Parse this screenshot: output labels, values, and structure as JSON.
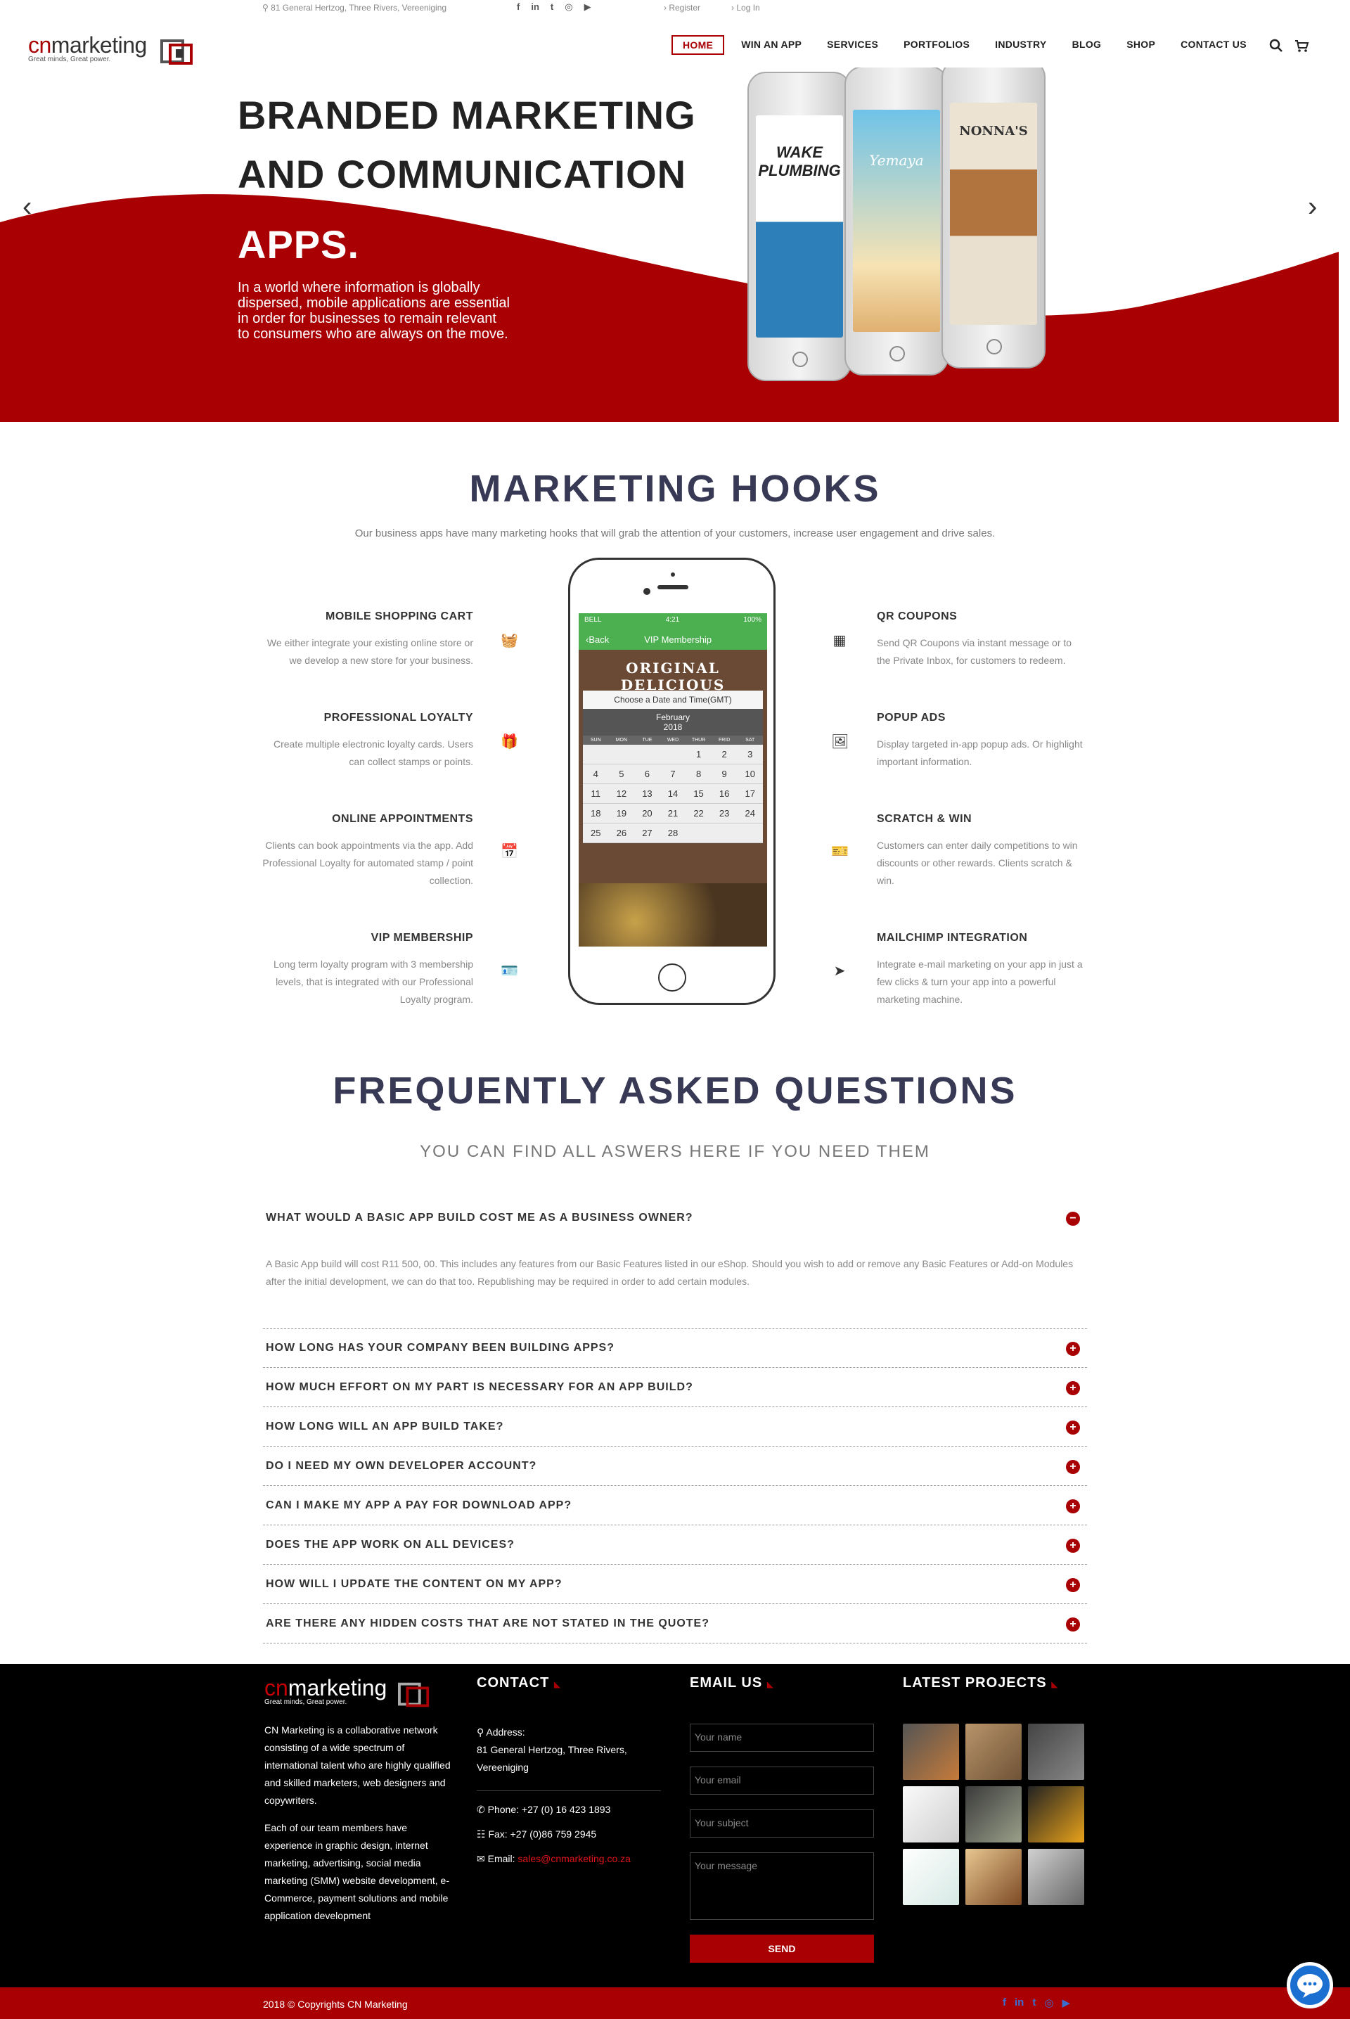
{
  "topbar": {
    "address": "81 General Hertzog, Three Rivers, Vereeniging",
    "register": "Register",
    "login": "Log In"
  },
  "logo": {
    "brand_prefix": "cn",
    "brand_suffix": "marketing",
    "tagline": "Great minds, Great power."
  },
  "nav": {
    "items": [
      "HOME",
      "WIN AN APP",
      "SERVICES",
      "PORTFOLIOS",
      "INDUSTRY",
      "BLOG",
      "SHOP",
      "CONTACT US"
    ]
  },
  "hero": {
    "title_line1": "BRANDED MARKETING",
    "title_line2": "AND COMMUNICATION",
    "title_line3": "APPS.",
    "text": "In a world where information is globally dispersed, mobile applications are essential in order for businesses to remain relevant to consumers who are always on the move.",
    "phones": [
      "WAKE PLUMBING",
      "Yemaya",
      "NONNA'S"
    ]
  },
  "hooks": {
    "title": "MARKETING HOOKS",
    "subtitle": "Our business apps have many marketing hooks that will grab the attention of your customers, increase user engagement and drive sales.",
    "left": [
      {
        "title": "MOBILE SHOPPING CART",
        "text": "We either integrate your existing online store or we develop a new store for your business.",
        "icon": "basket-icon"
      },
      {
        "title": "PROFESSIONAL LOYALTY",
        "text": "Create multiple electronic loyalty cards. Users can collect stamps or points.",
        "icon": "gift-icon"
      },
      {
        "title": "ONLINE APPOINTMENTS",
        "text": "Clients can book appointments via the app. Add Professional Loyalty for automated stamp / point collection.",
        "icon": "calendar-clock-icon"
      },
      {
        "title": "VIP MEMBERSHIP",
        "text": "Long term loyalty program with 3 membership levels, that is integrated with our Professional Loyalty program.",
        "icon": "id-card-icon"
      }
    ],
    "right": [
      {
        "title": "QR COUPONS",
        "text": "Send QR Coupons via instant message or to the Private Inbox, for customers to redeem.",
        "icon": "qr-code-icon"
      },
      {
        "title": "POPUP ADS",
        "text": "Display targeted in-app popup ads. Or highlight important information.",
        "icon": "image-file-icon"
      },
      {
        "title": "SCRATCH & WIN",
        "text": "Customers can enter daily competitions to win discounts or other rewards. Clients scratch & win.",
        "icon": "ticket-icon"
      },
      {
        "title": "MAILCHIMP INTEGRATION",
        "text": "Integrate e-mail marketing on your app in just a few clicks & turn your app into a powerful marketing machine.",
        "icon": "paper-plane-icon"
      }
    ],
    "phone": {
      "status_carrier": "BELL",
      "status_time": "4:21",
      "status_battery": "100%",
      "back": "Back",
      "screen_title": "VIP Membership",
      "banner": "ORIGINAL DELICIOUS",
      "choose": "Choose a Date and Time(GMT)",
      "month": "February",
      "year": "2018",
      "weekdays": [
        "SUN",
        "MON",
        "TUE",
        "WED",
        "THUR",
        "FRID",
        "SAT"
      ],
      "dates": [
        "",
        "",
        "",
        "",
        "1",
        "2",
        "3",
        "4",
        "5",
        "6",
        "7",
        "8",
        "9",
        "10",
        "11",
        "12",
        "13",
        "14",
        "15",
        "16",
        "17",
        "18",
        "19",
        "20",
        "21",
        "22",
        "23",
        "24",
        "25",
        "26",
        "27",
        "28",
        "",
        "",
        ""
      ]
    }
  },
  "faq": {
    "title": "FREQUENTLY ASKED QUESTIONS",
    "subtitle": "YOU CAN FIND ALL ASWERS HERE IF YOU NEED THEM",
    "open_question": "WHAT WOULD A BASIC APP BUILD COST ME AS A BUSINESS OWNER?",
    "open_answer": "A Basic App build will cost R11 500, 00. This includes any features from our Basic Features listed in our eShop. Should you wish to add or remove any Basic Features or Add-on Modules after the initial development, we can do that too. Republishing may be required in order to add certain modules.",
    "questions": [
      "HOW LONG HAS YOUR COMPANY BEEN BUILDING APPS?",
      "HOW MUCH EFFORT ON MY PART IS NECESSARY FOR AN APP BUILD?",
      "HOW LONG WILL AN APP BUILD TAKE?",
      "DO I NEED MY OWN DEVELOPER ACCOUNT?",
      "CAN I MAKE MY APP A PAY FOR DOWNLOAD APP?",
      "DOES THE APP WORK ON ALL DEVICES?",
      "HOW WILL I UPDATE THE CONTENT ON MY APP?",
      "ARE THERE ANY HIDDEN COSTS THAT ARE NOT STATED IN THE QUOTE?"
    ]
  },
  "footer": {
    "about_p1": "CN Marketing is a collaborative network consisting of a wide spectrum of international talent who are highly qualified and skilled marketers, web designers and copywriters.",
    "about_p2": "Each of our team members have experience in graphic design, internet marketing, advertising, social media marketing (SMM) website development, e-Commerce, payment solutions and mobile application development",
    "contact_title": "CONTACT",
    "address_label": "Address:",
    "address": "81 General Hertzog, Three Rivers, Vereeniging",
    "phone": "Phone: +27 (0) 16 423 1893",
    "fax": "Fax: +27 (0)86 759 2945",
    "email_label": "Email:",
    "email": "sales@cnmarketing.co.za",
    "email_title": "EMAIL US",
    "ph_name": "Your name",
    "ph_email": "Your email",
    "ph_subject": "Your subject",
    "ph_message": "Your message",
    "send": "SEND",
    "projects_title": "LATEST PROJECTS",
    "copyright": "2018 © Copyrights CN Marketing"
  },
  "colors": {
    "accent": "#a80003",
    "heading": "#383a55",
    "chat": "#1b6fd1"
  }
}
